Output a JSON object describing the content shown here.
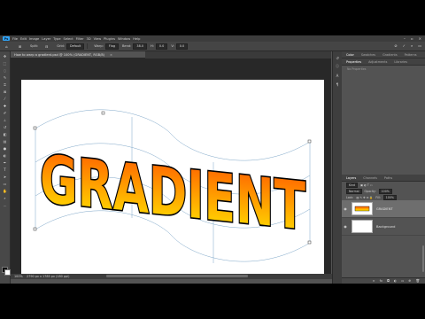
{
  "app": {
    "logo": "Ps"
  },
  "menu": [
    "File",
    "Edit",
    "Image",
    "Layer",
    "Type",
    "Select",
    "Filter",
    "3D",
    "View",
    "Plugins",
    "Window",
    "Help"
  ],
  "options": {
    "split_label": "Split:",
    "grid_label": "Grid:",
    "grid_value": "Default",
    "warp_label": "Warp:",
    "warp_value": "Flag",
    "bend_label": "Bend:",
    "bend_value": "38.0",
    "h_label": "H:",
    "h_value": "0.0",
    "v_label": "V:",
    "v_value": "0.0"
  },
  "document": {
    "tab_title": "How to warp a gradient.psd @ 100% (GRADIENT, RGB/8)",
    "close_glyph": "×",
    "canvas_text": "GRADIENT",
    "zoom": "100%",
    "status_info": "2790 px x 1785 px (180 ppi)"
  },
  "panels": {
    "top_tabs": [
      "Color",
      "Swatches",
      "Gradients",
      "Patterns"
    ],
    "sub_tabs": [
      "Properties",
      "Adjustments",
      "Libraries"
    ],
    "no_properties": "No Properties",
    "layers_tabs": [
      "Layers",
      "Channels",
      "Paths"
    ],
    "kind_label": "Kind",
    "blend_mode": "Normal",
    "opacity_label": "Opacity:",
    "opacity_value": "100%",
    "lock_label": "Lock:",
    "fill_label": "Fill:",
    "fill_value": "100%",
    "layers": [
      {
        "name": "GRADIENT",
        "selected": true
      },
      {
        "name": "Background",
        "selected": false
      }
    ]
  },
  "colors": {
    "gradient_top": "#ff5a00",
    "gradient_bottom": "#ffe800",
    "text_outline": "#000000",
    "ui_dark": "#535353"
  }
}
